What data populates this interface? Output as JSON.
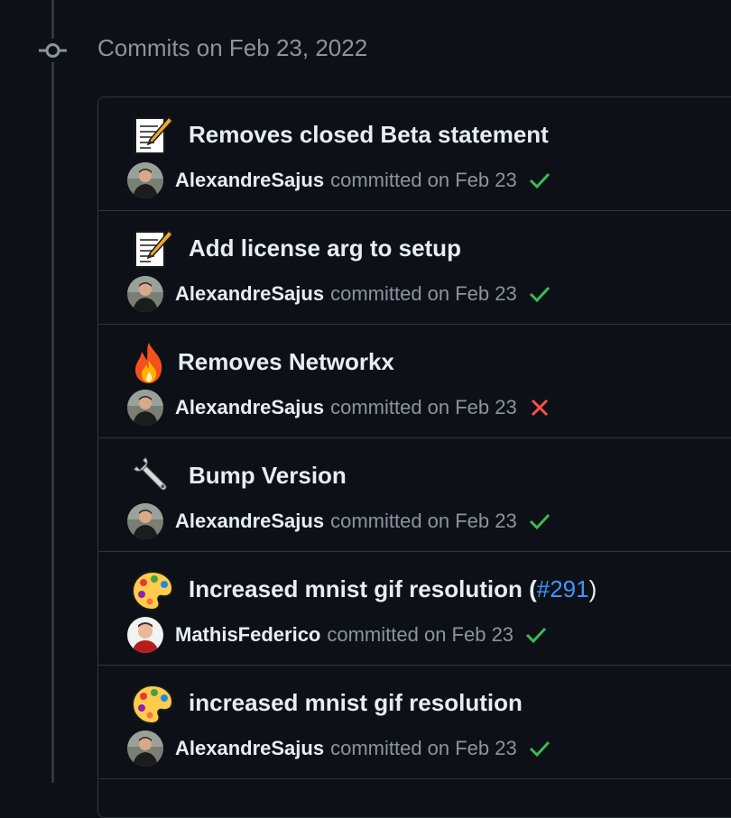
{
  "group": {
    "heading": "Commits on Feb 23, 2022"
  },
  "commits": [
    {
      "emoji_icon": "memo-icon",
      "title": "Removes closed Beta statement",
      "author": "AlexandreSajus",
      "committed_text": "committed on Feb 23",
      "status": "success"
    },
    {
      "emoji_icon": "memo-icon",
      "title": "Add license arg to setup",
      "author": "AlexandreSajus",
      "committed_text": "committed on Feb 23",
      "status": "success"
    },
    {
      "emoji_icon": "fire-icon",
      "title": "Removes Networkx",
      "author": "AlexandreSajus",
      "committed_text": "committed on Feb 23",
      "status": "failure"
    },
    {
      "emoji_icon": "wrench-icon",
      "title": "Bump Version",
      "author": "AlexandreSajus",
      "committed_text": "committed on Feb 23",
      "status": "success"
    },
    {
      "emoji_icon": "art-palette-icon",
      "title": "Increased mnist gif resolution (",
      "pr_link": "#291",
      "title_suffix": ")",
      "author": "MathisFederico",
      "committed_text": "committed on Feb 23",
      "status": "success"
    },
    {
      "emoji_icon": "art-palette-icon",
      "title": "increased mnist gif resolution",
      "author": "AlexandreSajus",
      "committed_text": "committed on Feb 23",
      "status": "success"
    }
  ],
  "colors": {
    "background": "#0d1117",
    "border": "#30363d",
    "text_primary": "#e6edf3",
    "text_muted": "#8b949e",
    "link": "#4493f8",
    "success": "#3fb950",
    "failure": "#f85149"
  }
}
